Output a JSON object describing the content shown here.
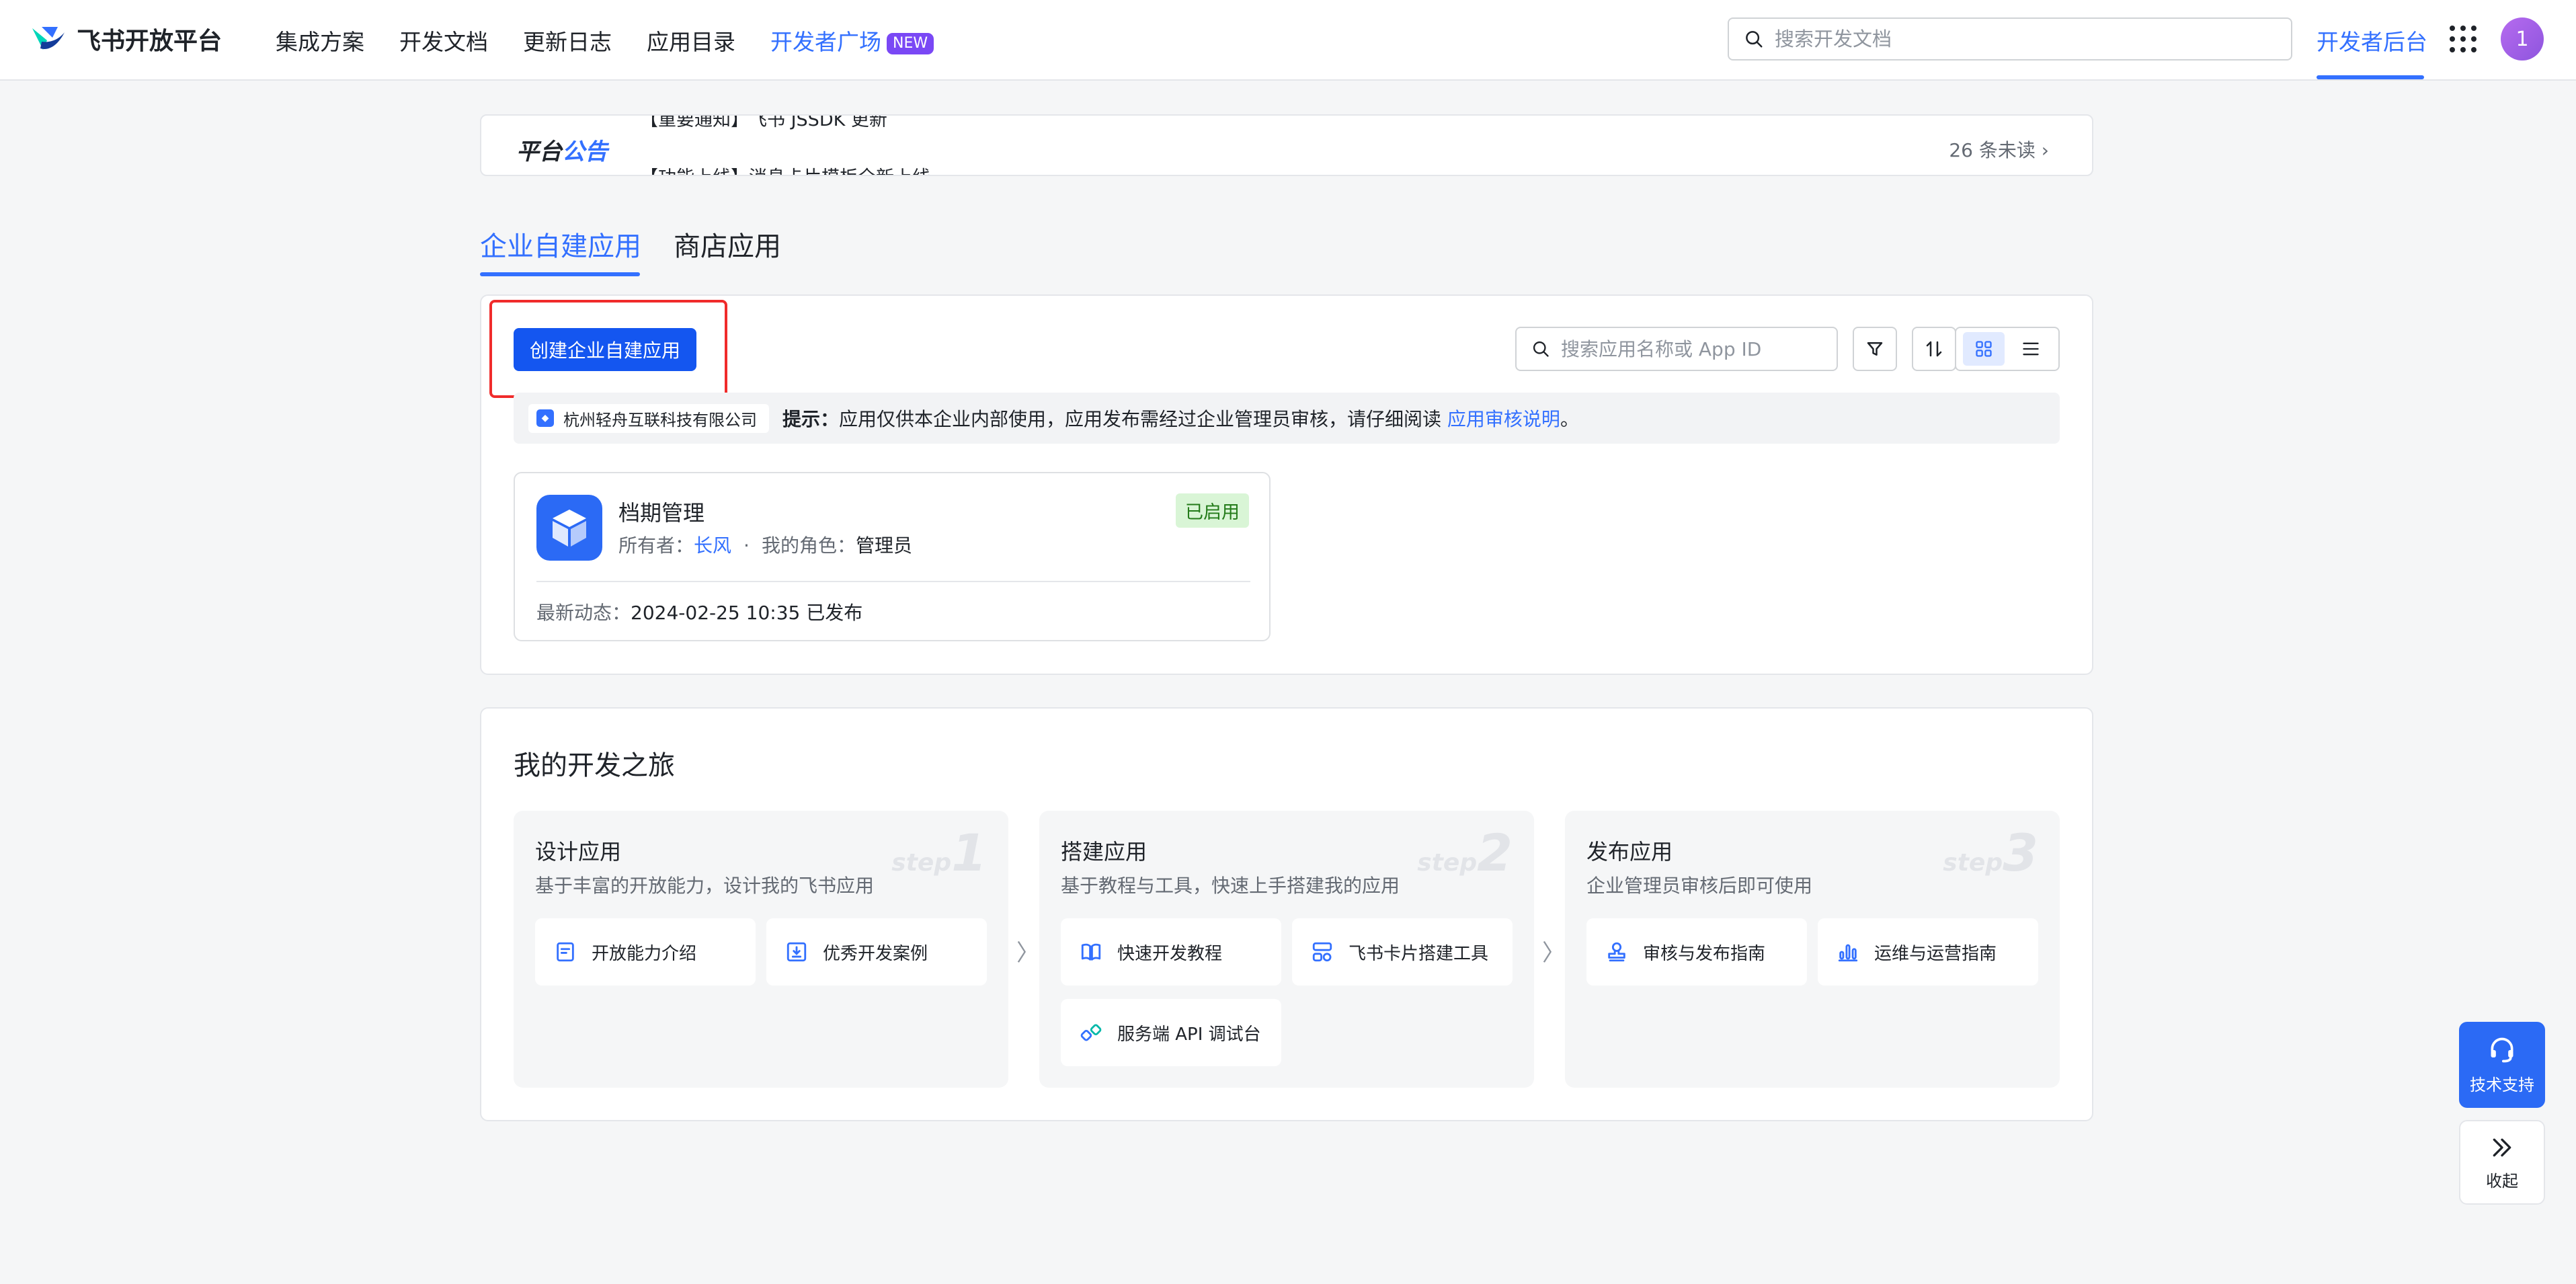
{
  "nav": {
    "brand": "飞书开放平台",
    "links": [
      "集成方案",
      "开发文档",
      "更新日志",
      "应用目录",
      "开发者广场"
    ],
    "new_badge": "NEW",
    "search_placeholder": "搜索开发文档",
    "dev_console": "开发者后台",
    "avatar_initial": "1"
  },
  "announcement": {
    "title_a": "平台",
    "title_b": "公告",
    "line1": "【重要通知】飞书 JSSDK 更新",
    "line2": "【功能上线】消息卡片模板全新上线",
    "unread": "26 条未读"
  },
  "tabs": [
    "企业自建应用",
    "商店应用"
  ],
  "apps_panel": {
    "create_button": "创建企业自建应用",
    "search_placeholder": "搜索应用名称或 App ID",
    "company": "杭州轻舟互联科技有限公司",
    "hint_label": "提示：",
    "hint_text": "应用仅供本企业内部使用，应用发布需经过企业管理员审核，请仔细阅读 ",
    "hint_link": "应用审核说明",
    "hint_end": "。"
  },
  "app_card": {
    "name": "档期管理",
    "status": "已启用",
    "owner_label": "所有者：",
    "owner": "长风",
    "sep": "·",
    "role_label": "我的角色：",
    "role": "管理员",
    "update_label": "最新动态：",
    "update_value": "2024-02-25 10:35 已发布"
  },
  "journey": {
    "title": "我的开发之旅",
    "steps": [
      {
        "title": "设计应用",
        "desc": "基于丰富的开放能力，设计我的飞书应用",
        "mark": "step",
        "num": "1",
        "tiles": [
          "开放能力介绍",
          "优秀开发案例"
        ]
      },
      {
        "title": "搭建应用",
        "desc": "基于教程与工具，快速上手搭建我的应用",
        "mark": "step",
        "num": "2",
        "tiles": [
          "快速开发教程",
          "飞书卡片搭建工具",
          "服务端 API 调试台"
        ]
      },
      {
        "title": "发布应用",
        "desc": "企业管理员审核后即可使用",
        "mark": "step",
        "num": "3",
        "tiles": [
          "审核与发布指南",
          "运维与运营指南"
        ]
      }
    ],
    "arrow": "〉"
  },
  "floating": {
    "support": "技术支持",
    "collapse": "收起"
  },
  "colors": {
    "accent": "#3370ff",
    "primary_button": "#1456f0",
    "highlight_box": "#f02b2b",
    "status_green": "#237b19"
  }
}
